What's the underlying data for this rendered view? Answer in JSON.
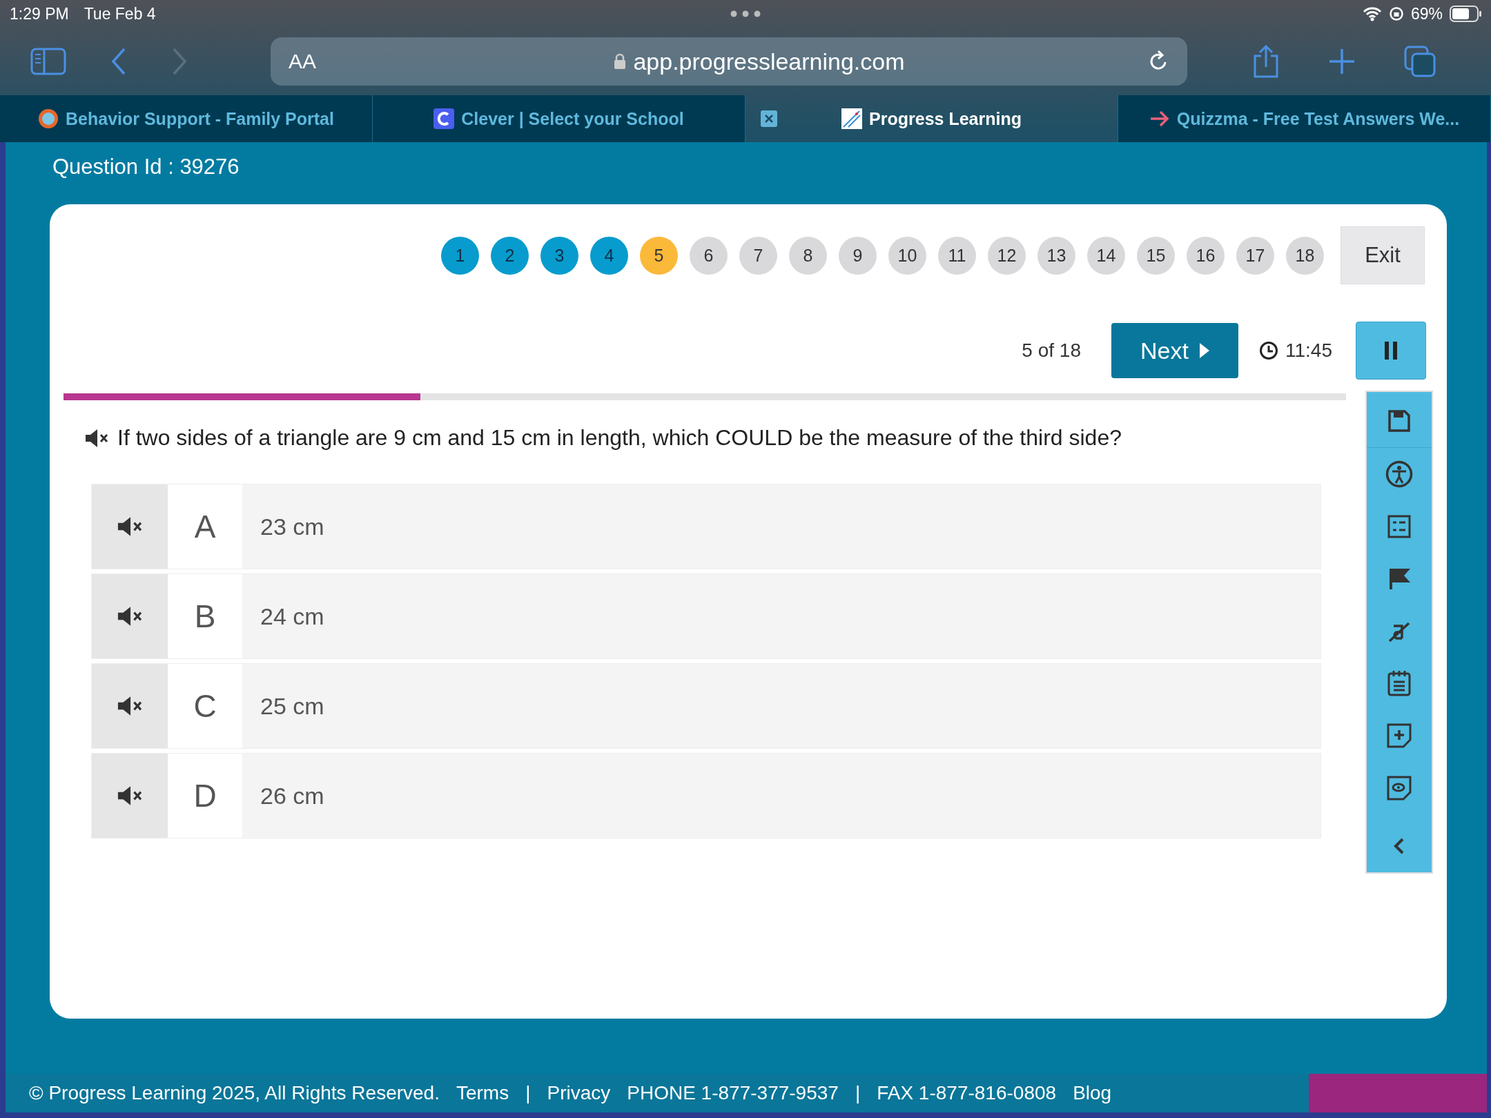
{
  "status_bar": {
    "time": "1:29 PM",
    "date": "Tue Feb 4",
    "battery": "69%"
  },
  "address_bar": {
    "text_size_label": "AA",
    "url": "app.progresslearning.com"
  },
  "tabs": [
    {
      "title": "Behavior Support - Family Portal",
      "selected": false
    },
    {
      "title": "Clever | Select your School",
      "selected": false
    },
    {
      "title": "Progress Learning",
      "selected": true
    },
    {
      "title": "Quizzma - Free Test Answers We...",
      "selected": false
    }
  ],
  "question_id": "Question Id : 39276",
  "question_nav": [
    {
      "label": "1",
      "answered": true,
      "selected": false
    },
    {
      "label": "2",
      "answered": true,
      "selected": false
    },
    {
      "label": "3",
      "answered": true,
      "selected": false
    },
    {
      "label": "4",
      "answered": true,
      "selected": false
    },
    {
      "label": "5",
      "answered": false,
      "selected": true
    },
    {
      "label": "6",
      "answered": false,
      "selected": false
    },
    {
      "label": "7",
      "answered": false,
      "selected": false
    },
    {
      "label": "8",
      "answered": false,
      "selected": false
    },
    {
      "label": "9",
      "answered": false,
      "selected": false
    },
    {
      "label": "10",
      "answered": false,
      "selected": false
    },
    {
      "label": "11",
      "answered": false,
      "selected": false
    },
    {
      "label": "12",
      "answered": false,
      "selected": false
    },
    {
      "label": "13",
      "answered": false,
      "selected": false
    },
    {
      "label": "14",
      "answered": false,
      "selected": false
    },
    {
      "label": "15",
      "answered": false,
      "selected": false
    },
    {
      "label": "16",
      "answered": false,
      "selected": false
    },
    {
      "label": "17",
      "answered": false,
      "selected": false
    },
    {
      "label": "18",
      "answered": false,
      "selected": false
    }
  ],
  "exit_button": "Exit",
  "position": "5 of 18",
  "next_button": "Next",
  "timer": "11:45",
  "progress": {
    "level": 0.278
  },
  "question": "If two sides of a triangle are 9 cm and 15 cm in length, which COULD be the measure of the third side?",
  "options": [
    {
      "letter": "A",
      "text": "23 cm",
      "selected": false
    },
    {
      "letter": "B",
      "text": "24 cm",
      "selected": false
    },
    {
      "letter": "C",
      "text": "25 cm",
      "selected": false
    },
    {
      "letter": "D",
      "text": "26 cm",
      "selected": false
    }
  ],
  "tools": [
    {
      "kind": "save"
    },
    {
      "kind": "accessibility"
    },
    {
      "kind": "checklist"
    },
    {
      "kind": "flag"
    },
    {
      "kind": "strike"
    },
    {
      "kind": "notepad"
    },
    {
      "kind": "add-note"
    },
    {
      "kind": "view-note"
    }
  ],
  "footer": {
    "copyright": "© Progress Learning 2025, All Rights Reserved.",
    "terms": "Terms",
    "separator_1": "|",
    "privacy": "Privacy",
    "phone": "PHONE 1-877-377-9537",
    "separator_2": "|",
    "fax": "FAX 1-877-816-0808",
    "blog": "Blog"
  }
}
